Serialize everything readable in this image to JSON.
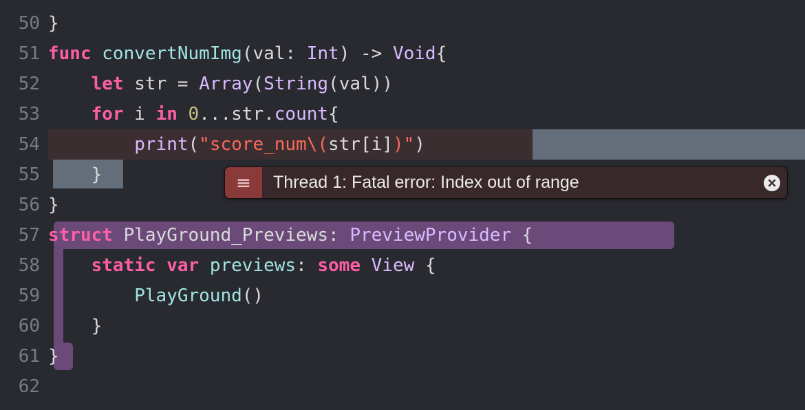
{
  "gutter": {
    "lines": [
      "50",
      "51",
      "52",
      "53",
      "54",
      "55",
      "56",
      "57",
      "58",
      "59",
      "60",
      "61",
      "62"
    ]
  },
  "code": {
    "l50": "}",
    "l51": {
      "func": "func",
      "name": "convertNumImg",
      "sig_open": "(",
      "arg": "val",
      "colon": ": ",
      "argtype": "Int",
      "sig_close": ") -> ",
      "ret": "Void",
      "brace": "{"
    },
    "l52": {
      "let": "let",
      "v": "str",
      "eq": " = ",
      "arr": "Array",
      "op": "(",
      "str": "String",
      "op2": "(",
      "val": "val",
      "cl": "))"
    },
    "l53": {
      "for": "for",
      "i": "i",
      "in": "in",
      "zero": "0",
      "range": "...",
      "s": "str",
      "dot": ".",
      "count": "count",
      "brace": "{"
    },
    "l54": {
      "print": "print",
      "op": "(",
      "s1": "\"score_num",
      "bs": "\\(",
      "expr": "str[i]",
      "cl": ")",
      "s2": "\"",
      "cp": ")"
    },
    "l55": "}",
    "l56": "}",
    "l57": {
      "struct": "struct",
      "name": "PlayGround_Previews",
      "colon": ": ",
      "proto": "PreviewProvider",
      "brace": " {"
    },
    "l58": {
      "static": "static",
      "var": "var",
      "prev": "previews",
      "colon": ": ",
      "some": "some",
      "view": "View",
      "brace": " {"
    },
    "l59": {
      "pg": "PlayGround",
      "call": "()"
    },
    "l60": "}",
    "l61": "}",
    "l62": ""
  },
  "error": {
    "message": "Thread 1: Fatal error: Index out of range"
  }
}
